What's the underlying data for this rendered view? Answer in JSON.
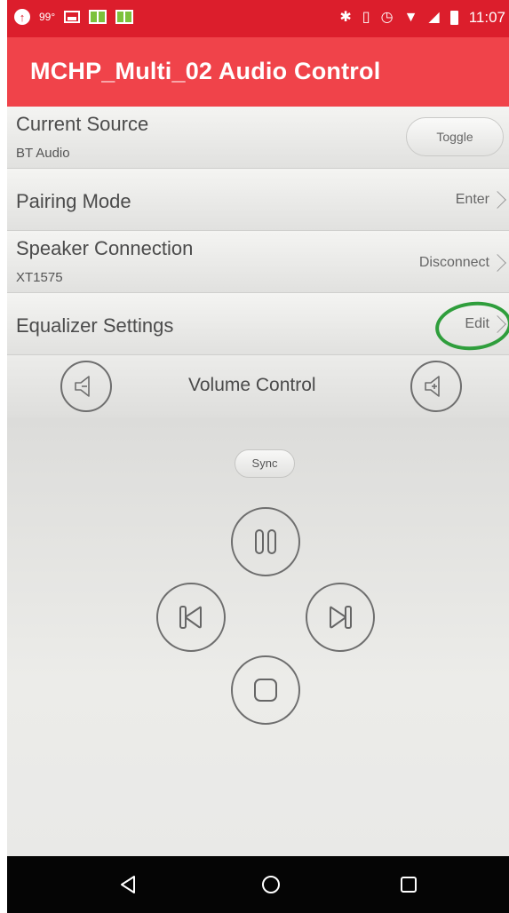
{
  "status_bar": {
    "temperature": "99°",
    "time": "11:07",
    "icons": [
      "notification-icon",
      "image-icon",
      "book-icon",
      "book-icon",
      "bluetooth-icon",
      "vibrate-icon",
      "alarm-icon",
      "wifi-icon",
      "signal-icon",
      "battery-icon"
    ]
  },
  "app_bar": {
    "title": "MCHP_Multi_02 Audio Control"
  },
  "rows": {
    "current_source": {
      "title": "Current Source",
      "value": "BT Audio",
      "action": "Toggle"
    },
    "pairing_mode": {
      "title": "Pairing Mode",
      "action": "Enter"
    },
    "speaker_connection": {
      "title": "Speaker Connection",
      "value": "XT1575",
      "action": "Disconnect"
    },
    "equalizer_settings": {
      "title": "Equalizer Settings",
      "action": "Edit"
    }
  },
  "volume": {
    "label": "Volume Control"
  },
  "playback": {
    "sync_label": "Sync"
  },
  "colors": {
    "status_bar": "#dc1e2c",
    "app_bar": "#f0434a",
    "highlight": "#2f9e3c",
    "nav_bar": "#050505"
  }
}
